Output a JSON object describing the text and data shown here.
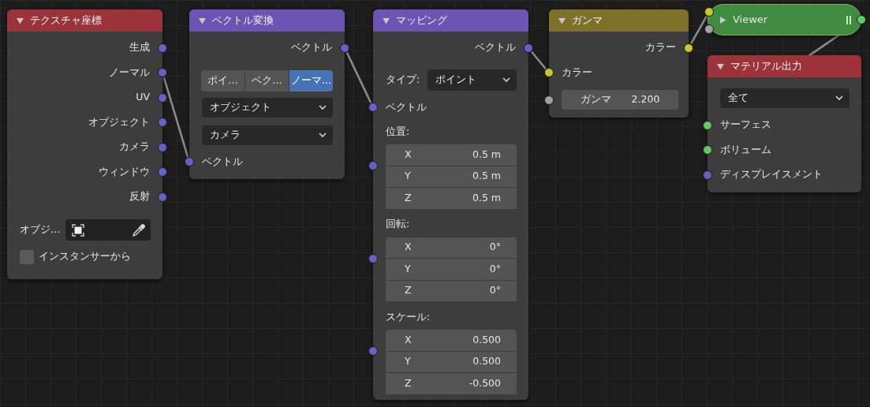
{
  "nodes": [
    {
      "kind": "full",
      "title": "テクスチャ座標",
      "color": "#9c333a",
      "expanded": true,
      "rows": [
        {
          "kind": "output",
          "label": "生成",
          "color": "#6363c7"
        },
        {
          "kind": "output",
          "label": "ノーマル",
          "color": "#6363c7"
        },
        {
          "kind": "output",
          "label": "UV",
          "color": "#6363c7"
        },
        {
          "kind": "output",
          "label": "オブジェクト",
          "color": "#6363c7"
        },
        {
          "kind": "output",
          "label": "カメラ",
          "color": "#6363c7"
        },
        {
          "kind": "output",
          "label": "ウィンドウ",
          "color": "#6363c7"
        },
        {
          "kind": "output",
          "label": "反射",
          "color": "#6363c7"
        },
        {
          "kind": "object_field",
          "label": "オブジ…"
        },
        {
          "kind": "checkbox",
          "label": "インスタンサーから",
          "checked": false
        }
      ]
    },
    {
      "kind": "full",
      "title": "ベクトル変換",
      "color": "#6b54b3",
      "expanded": true,
      "rows": [
        {
          "kind": "output",
          "label": "ベクトル",
          "color": "#6363c7"
        },
        {
          "kind": "segmented",
          "options": [
            {
              "label": "ポイ…",
              "selected": false
            },
            {
              "label": "ベク…",
              "selected": false
            },
            {
              "label": "ノーマ…",
              "selected": true
            }
          ]
        },
        {
          "kind": "dropdown",
          "value": "オブジェクト"
        },
        {
          "kind": "dropdown",
          "value": "カメラ"
        },
        {
          "kind": "input",
          "label": "ベクトル",
          "color": "#6363c7"
        }
      ]
    },
    {
      "kind": "full",
      "title": "マッピング",
      "color": "#6b54b3",
      "expanded": true,
      "rows": [
        {
          "kind": "output",
          "label": "ベクトル",
          "color": "#6363c7"
        },
        {
          "kind": "select_row",
          "label": "タイプ:",
          "value": "ポイント"
        },
        {
          "kind": "input",
          "label": "ベクトル",
          "color": "#6363c7"
        },
        {
          "kind": "vector",
          "label": "位置:",
          "color": "#6363c7",
          "fields": [
            {
              "axis": "X",
              "value": "0.5 m"
            },
            {
              "axis": "Y",
              "value": "0.5 m"
            },
            {
              "axis": "Z",
              "value": "0.5 m"
            }
          ]
        },
        {
          "kind": "vector",
          "label": "回転:",
          "color": "#6363c7",
          "fields": [
            {
              "axis": "X",
              "value": "0°"
            },
            {
              "axis": "Y",
              "value": "0°"
            },
            {
              "axis": "Z",
              "value": "0°"
            }
          ]
        },
        {
          "kind": "vector",
          "label": "スケール:",
          "color": "#6363c7",
          "fields": [
            {
              "axis": "X",
              "value": "0.500"
            },
            {
              "axis": "Y",
              "value": "0.500"
            },
            {
              "axis": "Z",
              "value": "-0.500"
            }
          ]
        }
      ]
    },
    {
      "kind": "full",
      "title": "ガンマ",
      "color": "#7d7029",
      "expanded": true,
      "rows": [
        {
          "kind": "output",
          "label": "カラー",
          "color": "#c7c729"
        },
        {
          "kind": "input",
          "label": "カラー",
          "color": "#c7c729"
        },
        {
          "kind": "value_input",
          "label": "ガンマ",
          "value": "2.200",
          "color": "#a1a1a1"
        }
      ]
    },
    {
      "kind": "compact",
      "title": "Viewer",
      "color": "#3f8c40",
      "expanded": false,
      "sockets": [
        {
          "kind": "input",
          "color": "#c7c729"
        },
        {
          "kind": "input",
          "color": "#a1a1a1"
        },
        {
          "kind": "output",
          "color": "#63c763"
        }
      ]
    },
    {
      "kind": "full",
      "title": "マテリアル出力",
      "color": "#9c333a",
      "expanded": true,
      "rows": [
        {
          "kind": "dropdown",
          "value": "全て"
        },
        {
          "kind": "input",
          "label": "サーフェス",
          "color": "#63c763"
        },
        {
          "kind": "input",
          "label": "ボリューム",
          "color": "#63c763"
        },
        {
          "kind": "input",
          "label": "ディスプレイスメント",
          "color": "#6363c7"
        }
      ]
    }
  ]
}
